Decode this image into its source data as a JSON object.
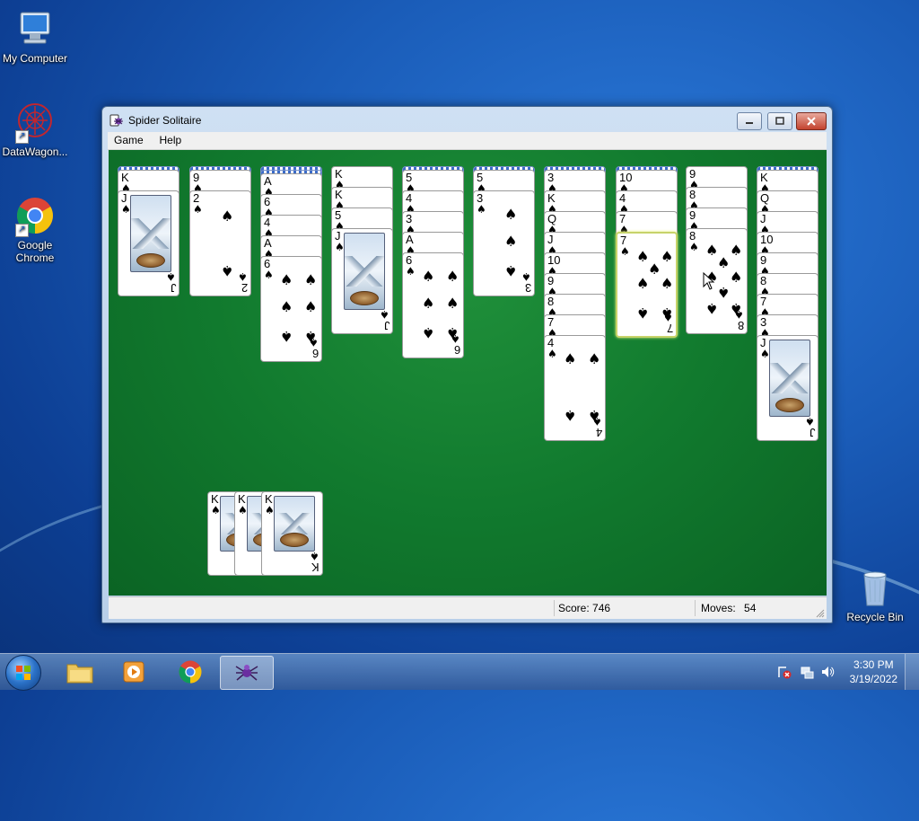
{
  "desktop": {
    "icons": [
      {
        "label": "My Computer"
      },
      {
        "label": "DataWagon..."
      },
      {
        "label": "Google Chrome"
      },
      {
        "label": "Recycle Bin"
      }
    ]
  },
  "window": {
    "title": "Spider Solitaire",
    "menu": [
      "Game",
      "Help"
    ],
    "status": {
      "score_label": "Score:",
      "score": "746",
      "moves_label": "Moves:",
      "moves": "54"
    }
  },
  "game": {
    "suit_symbol": "♠",
    "columns": [
      {
        "hidden": 1,
        "cards": [
          "K",
          "J"
        ]
      },
      {
        "hidden": 1,
        "cards": [
          "9",
          "2"
        ]
      },
      {
        "hidden": 2,
        "cards": [
          "A",
          "6",
          "4",
          "A",
          "6"
        ]
      },
      {
        "hidden": 0,
        "cards": [
          "K",
          "K",
          "5",
          "J"
        ]
      },
      {
        "hidden": 1,
        "cards": [
          "5",
          "4",
          "3",
          "A",
          "6"
        ]
      },
      {
        "hidden": 1,
        "cards": [
          "5",
          "3"
        ]
      },
      {
        "hidden": 1,
        "cards": [
          "3",
          "K",
          "Q",
          "J",
          "10",
          "9",
          "8",
          "7",
          "4"
        ]
      },
      {
        "hidden": 1,
        "cards": [
          "10",
          "4",
          "7",
          "7"
        ]
      },
      {
        "hidden": 0,
        "cards": [
          "9",
          "8",
          "9",
          "8"
        ]
      },
      {
        "hidden": 1,
        "cards": [
          "K",
          "Q",
          "J",
          "10",
          "9",
          "8",
          "7",
          "3",
          "J"
        ]
      }
    ],
    "completed_stacks": [
      "K",
      "K",
      "K"
    ]
  },
  "taskbar": {
    "clock_time": "3:30 PM",
    "clock_date": "3/19/2022",
    "pinned": [
      "explorer-icon",
      "media-player-icon",
      "chrome-icon",
      "spider-solitaire-icon"
    ]
  },
  "colors": {
    "felt": "#117a2e",
    "card_back": "#3a6bc9",
    "selection": "#c7d36a"
  }
}
